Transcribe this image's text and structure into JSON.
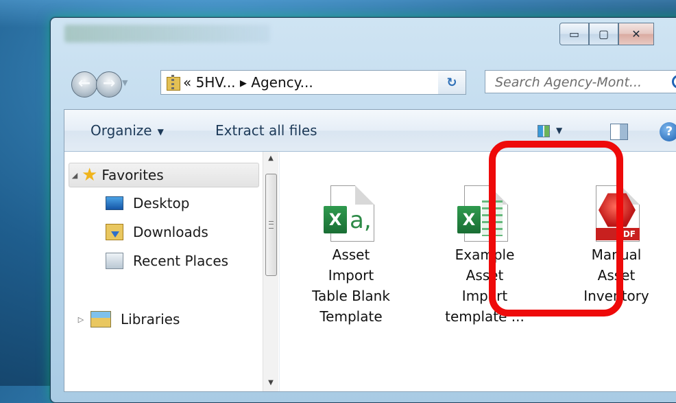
{
  "window": {
    "caption_buttons": {
      "minimize": "▭",
      "maximize": "▢",
      "close": "✕"
    }
  },
  "navigation": {
    "back_glyph": "←",
    "forward_glyph": "→",
    "address": "« 5HV... ▸ Agency...",
    "address_dropdown": "▼",
    "refresh_glyph": "↻",
    "search_placeholder": "Search Agency-Mont..."
  },
  "command_bar": {
    "organize": "Organize",
    "extract_all": "Extract all files",
    "help": "?"
  },
  "nav_pane": {
    "favorites": "Favorites",
    "items": [
      "Desktop",
      "Downloads",
      "Recent Places"
    ],
    "libraries": "Libraries"
  },
  "files": [
    {
      "name": "Asset\nImport\nTable Blank\nTemplate",
      "type": "excel-template"
    },
    {
      "name": "Example\nAsset\nImport\ntemplate ...",
      "type": "excel"
    },
    {
      "name": "Manual\nAsset\nInventory",
      "type": "pdf",
      "badge": "PDF"
    }
  ],
  "colors": {
    "highlight": "#ee0a0a",
    "accent": "#2d6fb7"
  }
}
